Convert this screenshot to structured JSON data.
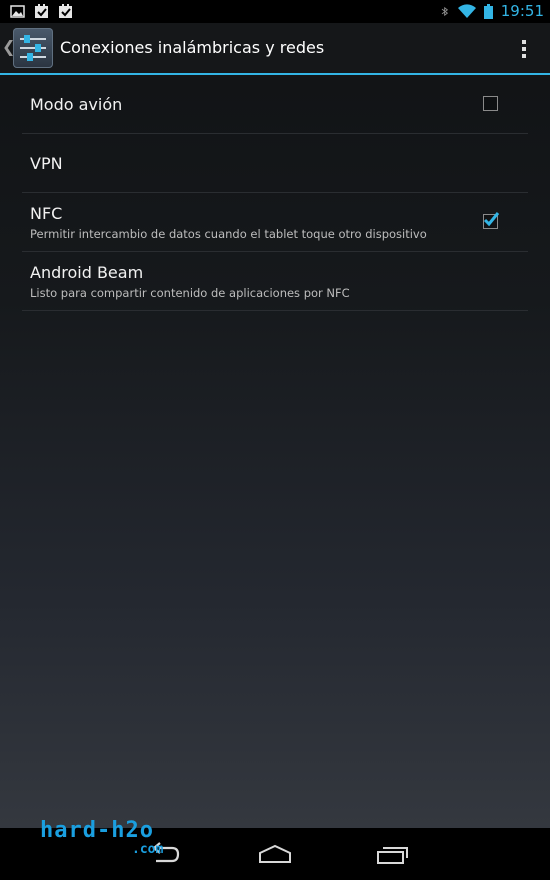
{
  "status_bar": {
    "time": "19:51",
    "notification_icons": [
      "image-icon",
      "checkbox-notification-icon",
      "checkbox-notification-icon"
    ],
    "system_icons": [
      "bluetooth-icon",
      "wifi-icon",
      "battery-icon"
    ],
    "accent_color": "#33b5e5"
  },
  "action_bar": {
    "title": "Conexiones inalámbricas y redes",
    "app_icon": "settings-sliders-icon",
    "overflow_icon": "overflow-menu-icon"
  },
  "settings_list": [
    {
      "title": "Modo avión",
      "summary": "",
      "has_checkbox": true,
      "checked": false
    },
    {
      "title": "VPN",
      "summary": "",
      "has_checkbox": false,
      "checked": false
    },
    {
      "title": "NFC",
      "summary": "Permitir intercambio de datos cuando el tablet toque otro dispositivo",
      "has_checkbox": true,
      "checked": true
    },
    {
      "title": "Android Beam",
      "summary": "Listo para compartir contenido de aplicaciones por NFC",
      "has_checkbox": false,
      "checked": false
    }
  ],
  "nav_bar": {
    "buttons": [
      "back-icon",
      "home-icon",
      "recent-apps-icon"
    ]
  },
  "watermark": {
    "text": "hard-h2o",
    "sub": ".com",
    "color": "#1a9fe0"
  }
}
